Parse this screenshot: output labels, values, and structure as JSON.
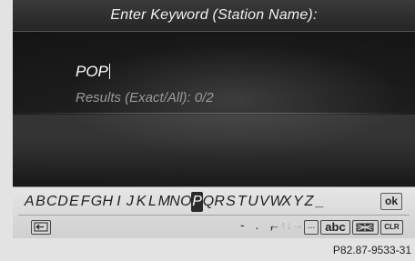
{
  "header": {
    "title": "Enter Keyword (Station Name):"
  },
  "entry": {
    "value": "POP"
  },
  "results": {
    "label": "Results (Exact/All): 0/2"
  },
  "keyboard": {
    "letters": [
      "A",
      "B",
      "C",
      "D",
      "E",
      "F",
      "G",
      "H",
      "I",
      "J",
      "K",
      "L",
      "M",
      "N",
      "O",
      "P",
      "Q",
      "R",
      "S",
      "T",
      "U",
      "V",
      "W",
      "X",
      "Y",
      "Z",
      "_"
    ],
    "selected_letter": "P",
    "ok_label": "ok",
    "punctuation": "- . ,",
    "arrow_left": "←",
    "arrow_up": "↑",
    "arrow_down": "↓",
    "arrow_right": "→",
    "ellipsis_label": "...",
    "abc_label": "abc",
    "clr_label": "CLR",
    "back_icon": "back-return-icon",
    "flag_icon": "flag-language-icon"
  },
  "footer": {
    "reference": "P82.87-9533-31"
  },
  "colors": {
    "screen_bg": "#161616",
    "keyboard_bg": "#d8d8d8",
    "selected_key_bg": "#2a2a2a"
  }
}
